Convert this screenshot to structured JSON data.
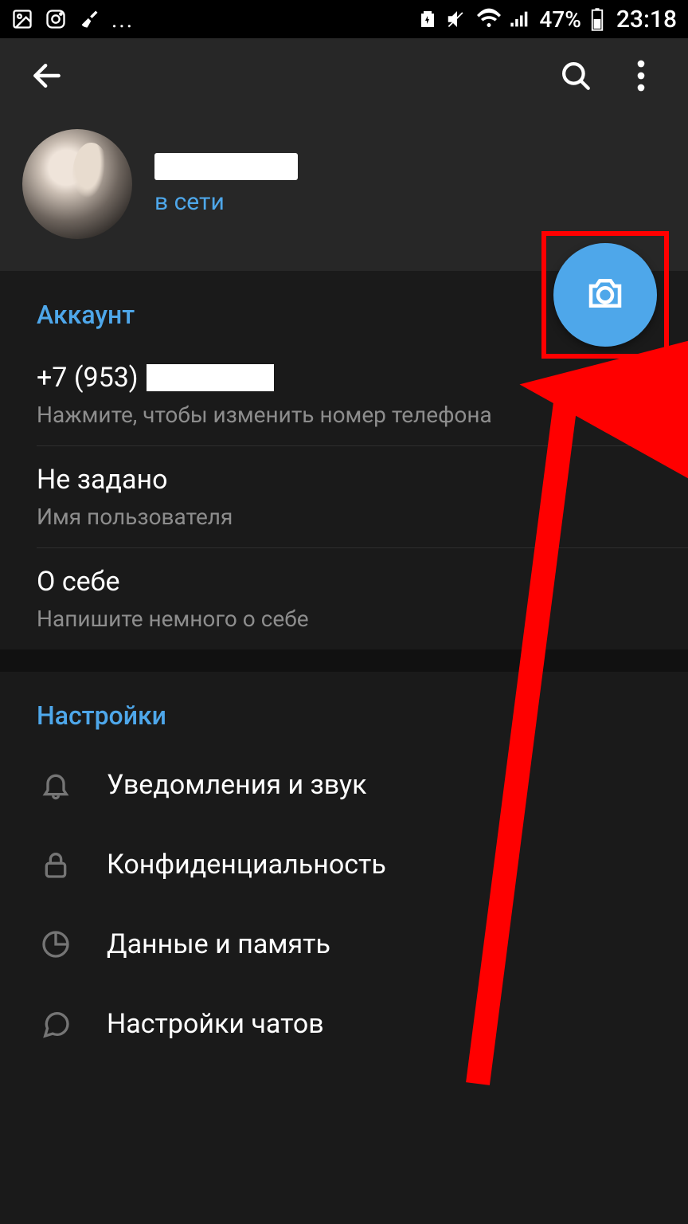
{
  "statusbar": {
    "battery_pct": "47%",
    "time": "23:18"
  },
  "profile": {
    "status": "в сети"
  },
  "account": {
    "section_title": "Аккаунт",
    "phone_prefix": "+7 (953)",
    "phone_sub": "Нажмите, чтобы изменить номер телефона",
    "username_value": "Не задано",
    "username_sub": "Имя пользователя",
    "bio_value": "О себе",
    "bio_sub": "Напишите немного о себе"
  },
  "settings": {
    "section_title": "Настройки",
    "notifications": "Уведомления и звук",
    "privacy": "Конфиденциальность",
    "data": "Данные и память",
    "chat": "Настройки чатов"
  },
  "annotation": {
    "highlight": "camera-fab",
    "color": "#ff0000"
  }
}
